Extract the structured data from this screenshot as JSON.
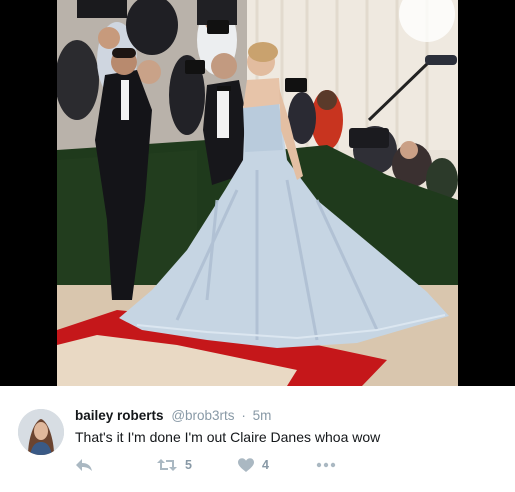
{
  "tweet": {
    "display_name": "bailey roberts",
    "handle": "@brob3rts",
    "separator": "·",
    "time": "5m",
    "text": "That's it I'm done I'm out Claire Danes whoa wow",
    "retweet_count": "5",
    "like_count": "4"
  },
  "icons": {
    "reply": "reply-icon",
    "retweet": "retweet-icon",
    "like": "heart-icon",
    "more": "more-dots-icon"
  },
  "colors": {
    "icon_gray": "#aab8c2",
    "meta_gray": "#8899a6",
    "text": "#14171a",
    "gown": "#c6d5e3",
    "carpet": "#c5171a"
  }
}
